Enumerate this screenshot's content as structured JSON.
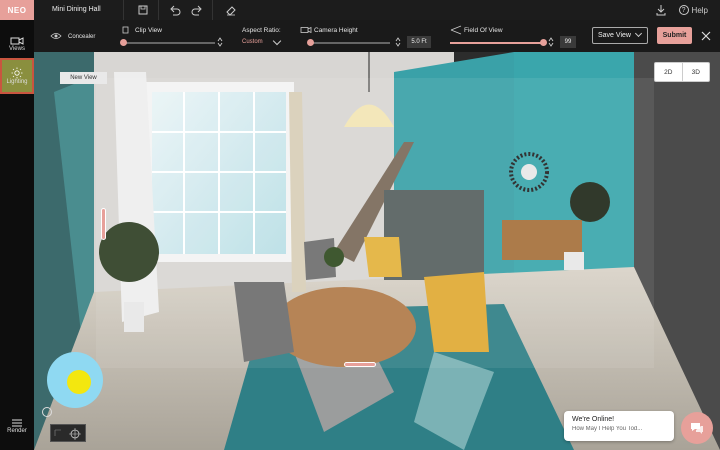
{
  "app": {
    "logo": "NEO",
    "document_title": "Mini Dining Hall",
    "help_label": "Help",
    "help_icon": "?"
  },
  "sidebar": {
    "items": [
      {
        "label": "Views",
        "icon": "camera-icon"
      },
      {
        "label": "Lighting",
        "icon": "sun-icon",
        "active": true
      },
      {
        "label": "Render",
        "icon": "render-icon"
      }
    ]
  },
  "toolbar": {
    "concealer_label": "Concealer",
    "clip_view": {
      "label": "Clip View",
      "value": 0.0
    },
    "aspect_ratio": {
      "label": "Aspect Ratio:",
      "value": "Custom"
    },
    "camera_height": {
      "label": "Camera Height",
      "value": "5.0 Ft",
      "slider": 0.0
    },
    "field_of_view": {
      "label": "Field Of View",
      "value": "99",
      "slider": 0.97
    },
    "save_view_label": "Save View",
    "submit_label": "Submit"
  },
  "scene": {
    "new_view_label": "New View",
    "view_modes": [
      "2D",
      "3D"
    ]
  },
  "chat": {
    "title": "We're Online!",
    "subtitle": "How May I Help You Tod..."
  },
  "colors": {
    "accent": "#e7a09a",
    "active_sidebar": "#8a8f3e",
    "active_border": "#c9553f",
    "light_widget": "#8fd9f2",
    "sun": "#f3e70f"
  }
}
